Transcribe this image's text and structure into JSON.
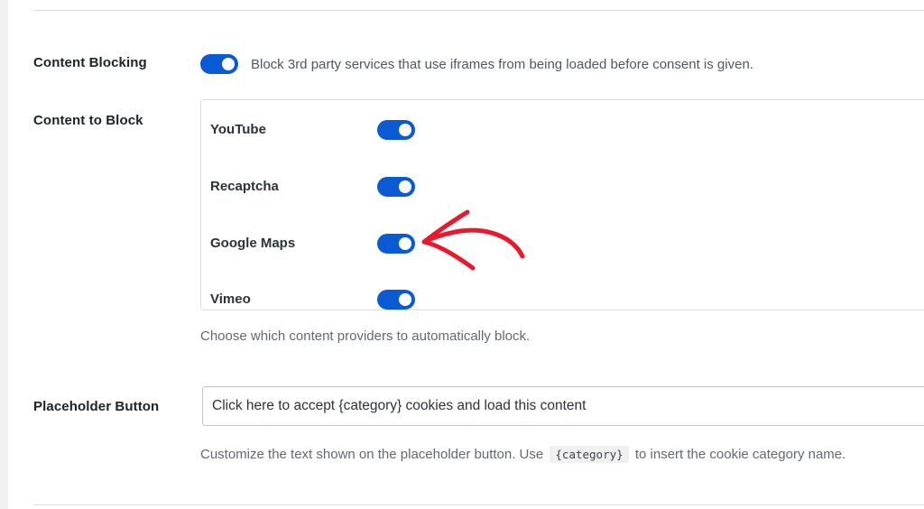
{
  "content_blocking": {
    "label": "Content Blocking",
    "enabled": true,
    "description": "Block 3rd party services that use iframes from being loaded before consent is given."
  },
  "content_to_block": {
    "label": "Content to Block",
    "providers": [
      {
        "name": "YouTube",
        "enabled": true
      },
      {
        "name": "Recaptcha",
        "enabled": true
      },
      {
        "name": "Google Maps",
        "enabled": true
      },
      {
        "name": "Vimeo",
        "enabled": true
      }
    ],
    "help": "Choose which content providers to automatically block."
  },
  "placeholder_button": {
    "label": "Placeholder Button",
    "value": "Click here to accept {category} cookies and load this content",
    "help_before": "Customize the text shown on the placeholder button. Use",
    "help_code": "{category}",
    "help_after": "to insert the cookie category name."
  },
  "annotation": {
    "icon": "red-arrow-icon",
    "color": "#e8192c"
  },
  "colors": {
    "toggle_on": "#0a5bd3",
    "background": "#f0f0f1",
    "panel": "#ffffff"
  }
}
